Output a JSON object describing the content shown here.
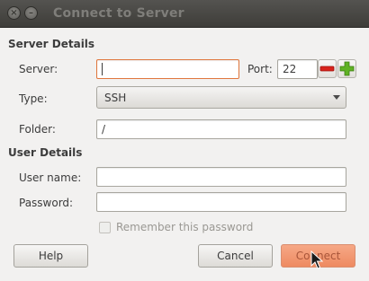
{
  "window": {
    "title": "Connect to Server"
  },
  "server_details": {
    "heading": "Server Details",
    "server_label": "Server:",
    "server_value": "",
    "port_label": "Port:",
    "port_value": "22",
    "type_label": "Type:",
    "type_value": "SSH",
    "folder_label": "Folder:",
    "folder_value": "/"
  },
  "user_details": {
    "heading": "User Details",
    "username_label": "User name:",
    "username_value": "",
    "password_label": "Password:",
    "password_value": "",
    "remember_label": "Remember this password",
    "remember_checked": false
  },
  "buttons": {
    "help": "Help",
    "cancel": "Cancel",
    "connect": "Connect"
  },
  "colors": {
    "focus_border": "#e0763d",
    "remove_icon": "#d8231c",
    "add_icon": "#5fb224",
    "connect_button": "#ee8a61"
  }
}
